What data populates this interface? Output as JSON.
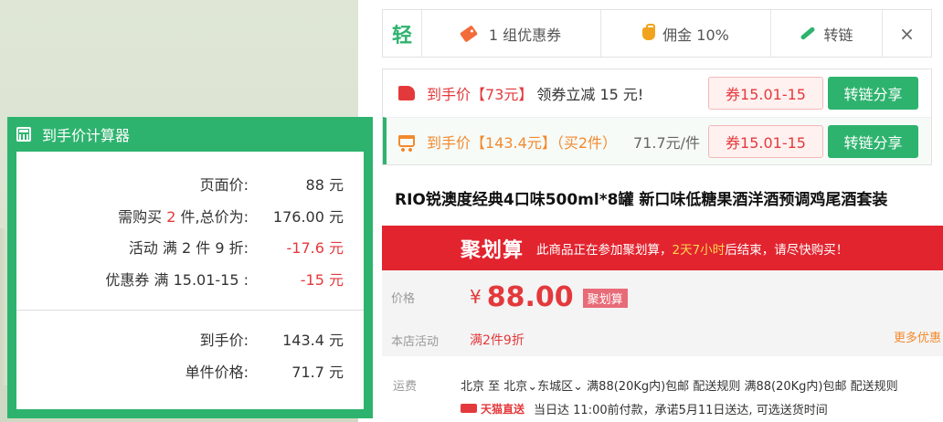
{
  "calculator": {
    "title": "到手价计算器",
    "rows": [
      {
        "label": "页面价:",
        "value": "88 元"
      },
      {
        "label_prefix": "需购买 ",
        "label_count": "2",
        "label_suffix": " 件,总价为:",
        "value": "176.00 元"
      },
      {
        "label": "活动 满 2 件 9 折:",
        "value": "-17.6 元"
      },
      {
        "label": "优惠券 满 15.01-15 :",
        "value": "-15 元"
      }
    ],
    "result": [
      {
        "label": "到手价:",
        "value": "143.4 元"
      },
      {
        "label": "单件价格:",
        "value": "71.7 元"
      }
    ]
  },
  "toolbar": {
    "logo": "轻",
    "coupon": "1 组优惠券",
    "commission": "佣金 10%",
    "link": "转链",
    "close": "×"
  },
  "offers": [
    {
      "prefix": "到手价",
      "price": "【73元】",
      "note": "领券立减 15 元!",
      "coupon_btn": "券15.01-15",
      "share_btn": "转链分享"
    },
    {
      "prefix": "到手价",
      "price": "【143.4元】",
      "qty": "（买2件）",
      "note": "71.7元/件",
      "coupon_btn": "券15.01-15",
      "share_btn": "转链分享"
    }
  ],
  "product": {
    "title": "RIO锐澳度经典4口味500ml*8罐 新口味低糖果酒洋酒预调鸡尾酒套装"
  },
  "juhuasuan": {
    "logo": "聚划算",
    "text_before": "此商品正在参加聚划算，",
    "highlight": "2天7小时",
    "text_after": "后结束，请尽快购买！"
  },
  "price": {
    "label": "价格",
    "yen": "¥",
    "amount": "88.00",
    "tag": "聚划算",
    "promo_label": "本店活动",
    "promo": "满2件9折",
    "more": "更多优惠"
  },
  "shipping": {
    "label": "运费",
    "line1": "北京  至  北京⌄东城区⌄  满88(20Kg内)包邮  配送规则  满88(20Kg内)包邮  配送规则",
    "tmall": "天猫直送",
    "line2": "当日达 11:00前付款，承诺5月11日送达, 可选送货时间"
  }
}
